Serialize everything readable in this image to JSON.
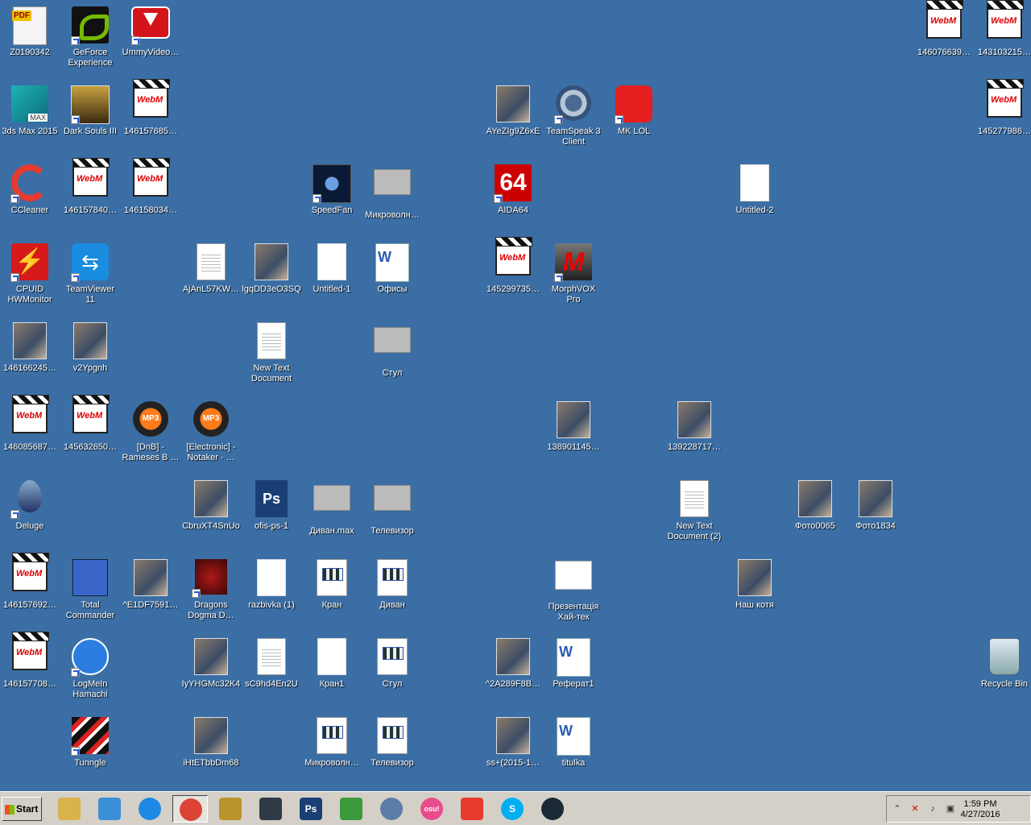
{
  "desktop_icons": [
    {
      "label": "Z0190342",
      "icon": "pdf-file-icon",
      "col": 0,
      "row": 0,
      "shortcut": false
    },
    {
      "label": "GeForce Experience",
      "icon": "nvidia-icon",
      "col": 1,
      "row": 0,
      "shortcut": true
    },
    {
      "label": "UmmyVideo…",
      "icon": "download-icon",
      "col": 2,
      "row": 0,
      "shortcut": true
    },
    {
      "label": "3ds Max 2015",
      "icon": "3dsmax-icon",
      "col": 0,
      "row": 1,
      "shortcut": false
    },
    {
      "label": "Dark Souls III",
      "icon": "game-icon",
      "col": 1,
      "row": 1,
      "shortcut": true
    },
    {
      "label": "146157685…",
      "icon": "webm-icon",
      "col": 2,
      "row": 1,
      "shortcut": false
    },
    {
      "label": "AYeZIg9Z6xE",
      "icon": "photo-icon",
      "col": 8,
      "row": 1,
      "shortcut": false
    },
    {
      "label": "TeamSpeak 3 Client",
      "icon": "teamspeak-icon",
      "col": 9,
      "row": 1,
      "shortcut": true
    },
    {
      "label": "MK LOL",
      "icon": "mk-lol-icon",
      "col": 10,
      "row": 1,
      "shortcut": true
    },
    {
      "label": "CCleaner",
      "icon": "ccleaner-icon",
      "col": 0,
      "row": 2,
      "shortcut": true
    },
    {
      "label": "146157840…",
      "icon": "webm-icon",
      "col": 1,
      "row": 2,
      "shortcut": false
    },
    {
      "label": "146158034…",
      "icon": "webm-icon",
      "col": 2,
      "row": 2,
      "shortcut": false
    },
    {
      "label": "SpeedFan",
      "icon": "speedfan-icon",
      "col": 5,
      "row": 2,
      "shortcut": true
    },
    {
      "label": "Микроволн…",
      "icon": "model-file-icon",
      "col": 6,
      "row": 2,
      "shortcut": false
    },
    {
      "label": "AIDA64",
      "icon": "aida64-icon",
      "col": 8,
      "row": 2,
      "shortcut": true
    },
    {
      "label": "Untitled-2",
      "icon": "image-icon",
      "col": 12,
      "row": 2,
      "shortcut": false
    },
    {
      "label": "CPUID HWMonitor",
      "icon": "cpuid-icon",
      "col": 0,
      "row": 3,
      "shortcut": true
    },
    {
      "label": "TeamViewer 11",
      "icon": "teamviewer-icon",
      "col": 1,
      "row": 3,
      "shortcut": true
    },
    {
      "label": "AjAnL57KW…",
      "icon": "text-file-icon",
      "col": 3,
      "row": 3,
      "shortcut": false
    },
    {
      "label": "lgqDD3eO3SQ",
      "icon": "photo-icon",
      "col": 4,
      "row": 3,
      "shortcut": false
    },
    {
      "label": "Untitled-1",
      "icon": "image-icon",
      "col": 5,
      "row": 3,
      "shortcut": false
    },
    {
      "label": "Офисы",
      "icon": "word-doc-icon",
      "col": 6,
      "row": 3,
      "shortcut": false
    },
    {
      "label": "145299735…",
      "icon": "webm-icon",
      "col": 8,
      "row": 3,
      "shortcut": false
    },
    {
      "label": "MorphVOX Pro",
      "icon": "morphvox-icon",
      "col": 9,
      "row": 3,
      "shortcut": true
    },
    {
      "label": "146166245…",
      "icon": "photo-icon",
      "col": 0,
      "row": 4,
      "shortcut": false
    },
    {
      "label": "v2Ypgnh",
      "icon": "photo-icon",
      "col": 1,
      "row": 4,
      "shortcut": false
    },
    {
      "label": "New Text Document",
      "icon": "text-file-icon",
      "col": 4,
      "row": 4,
      "shortcut": false
    },
    {
      "label": "Стул",
      "icon": "model-file-icon",
      "col": 6,
      "row": 4,
      "shortcut": false
    },
    {
      "label": "146085687…",
      "icon": "webm-icon",
      "col": 0,
      "row": 5,
      "shortcut": false
    },
    {
      "label": "145632650…",
      "icon": "webm-icon",
      "col": 1,
      "row": 5,
      "shortcut": false
    },
    {
      "label": "[DnB] - Rameses B …",
      "icon": "mp3-icon",
      "col": 2,
      "row": 5,
      "shortcut": false
    },
    {
      "label": "[Electronic] - Notaker - …",
      "icon": "mp3-icon",
      "col": 3,
      "row": 5,
      "shortcut": false
    },
    {
      "label": "138901145…",
      "icon": "photo-icon",
      "col": 9,
      "row": 5,
      "shortcut": false
    },
    {
      "label": "139228717…",
      "icon": "photo-icon",
      "col": 11,
      "row": 5,
      "shortcut": false
    },
    {
      "label": "Deluge",
      "icon": "deluge-icon",
      "col": 0,
      "row": 6,
      "shortcut": true
    },
    {
      "label": "CbruXT4SnUo",
      "icon": "photo-icon",
      "col": 3,
      "row": 6,
      "shortcut": false
    },
    {
      "label": "ofis-ps-1",
      "icon": "psd-icon",
      "col": 4,
      "row": 6,
      "shortcut": false
    },
    {
      "label": "Диван.max",
      "icon": "model-file-icon",
      "col": 5,
      "row": 6,
      "shortcut": false
    },
    {
      "label": "Телевизор",
      "icon": "model-file-icon",
      "col": 6,
      "row": 6,
      "shortcut": false
    },
    {
      "label": "New Text Document (2)",
      "icon": "text-file-icon",
      "col": 11,
      "row": 6,
      "shortcut": false
    },
    {
      "label": "Фото0065",
      "icon": "photo-icon",
      "col": 13,
      "row": 6,
      "shortcut": false
    },
    {
      "label": "Фото1834",
      "icon": "photo-icon",
      "col": 14,
      "row": 6,
      "shortcut": false
    },
    {
      "label": "146157692…",
      "icon": "webm-icon",
      "col": 0,
      "row": 7,
      "shortcut": false
    },
    {
      "label": "Total Commander",
      "icon": "floppy-icon",
      "col": 1,
      "row": 7,
      "shortcut": false
    },
    {
      "label": "^E1DF7591…",
      "icon": "photo-icon",
      "col": 2,
      "row": 7,
      "shortcut": false
    },
    {
      "label": "Dragons Dogma D…",
      "icon": "dragon-icon",
      "col": 3,
      "row": 7,
      "shortcut": true
    },
    {
      "label": "razbivka (1)",
      "icon": "image-icon",
      "col": 4,
      "row": 7,
      "shortcut": false
    },
    {
      "label": "Кран",
      "icon": "app-file-icon",
      "col": 5,
      "row": 7,
      "shortcut": false
    },
    {
      "label": "Диван",
      "icon": "app-file-icon",
      "col": 6,
      "row": 7,
      "shortcut": false
    },
    {
      "label": "Презентація Хай-тек",
      "icon": "presentation-icon",
      "col": 9,
      "row": 7,
      "shortcut": false
    },
    {
      "label": "Наш котя",
      "icon": "photo-icon",
      "col": 12,
      "row": 7,
      "shortcut": false
    },
    {
      "label": "146157708…",
      "icon": "webm-icon",
      "col": 0,
      "row": 8,
      "shortcut": false
    },
    {
      "label": "LogMeIn Hamachi",
      "icon": "hamachi-icon",
      "col": 1,
      "row": 8,
      "shortcut": true
    },
    {
      "label": "IyYHGMc32K4",
      "icon": "photo-icon",
      "col": 3,
      "row": 8,
      "shortcut": false
    },
    {
      "label": "sC9hd4En2U",
      "icon": "text-file-icon",
      "col": 4,
      "row": 8,
      "shortcut": false
    },
    {
      "label": "Кран1",
      "icon": "image-icon",
      "col": 5,
      "row": 8,
      "shortcut": false
    },
    {
      "label": "Стул",
      "icon": "app-file-icon",
      "col": 6,
      "row": 8,
      "shortcut": false
    },
    {
      "label": "^2A289F8B…",
      "icon": "photo-icon",
      "col": 8,
      "row": 8,
      "shortcut": false
    },
    {
      "label": "Реферат1",
      "icon": "word-doc-icon",
      "col": 9,
      "row": 8,
      "shortcut": false
    },
    {
      "label": "Recycle Bin",
      "icon": "recycle-bin-icon",
      "col": 16,
      "row": 8,
      "shortcut": false
    },
    {
      "label": "Tunngle",
      "icon": "tunngle-icon",
      "col": 1,
      "row": 9,
      "shortcut": true
    },
    {
      "label": "iHtETbbDm68",
      "icon": "photo-icon",
      "col": 3,
      "row": 9,
      "shortcut": false
    },
    {
      "label": "Микроволн…",
      "icon": "app-file-icon",
      "col": 5,
      "row": 9,
      "shortcut": false
    },
    {
      "label": "Телевизор",
      "icon": "app-file-icon",
      "col": 6,
      "row": 9,
      "shortcut": false
    },
    {
      "label": "ss+(2015-1…",
      "icon": "photo-icon",
      "col": 8,
      "row": 9,
      "shortcut": false
    },
    {
      "label": "titulka",
      "icon": "word-doc-icon",
      "col": 9,
      "row": 9,
      "shortcut": false
    },
    {
      "label": "146076639…",
      "icon": "webm-icon",
      "col": 15,
      "row": 0,
      "shortcut": false
    },
    {
      "label": "143103215…",
      "icon": "webm-icon",
      "col": 16,
      "row": 0,
      "shortcut": false
    },
    {
      "label": "145277986…",
      "icon": "webm-icon",
      "col": 16,
      "row": 1,
      "shortcut": false
    }
  ],
  "taskbar": {
    "start_label": "Start",
    "apps": [
      {
        "name": "explorer-icon",
        "color": "#d9b24a"
      },
      {
        "name": "media-player-icon",
        "color": "#3b8fd6"
      },
      {
        "name": "internet-explorer-icon",
        "color": "#1e88e5"
      },
      {
        "name": "chrome-icon",
        "color": "#db4437",
        "active": true
      },
      {
        "name": "league-of-legends-icon",
        "color": "#b9952c"
      },
      {
        "name": "steam-like-icon",
        "color": "#2e3a45"
      },
      {
        "name": "photoshop-icon",
        "color": "#1a3f74",
        "text": "Ps"
      },
      {
        "name": "money-icon",
        "color": "#3c9a3c"
      },
      {
        "name": "teamspeak-icon",
        "color": "#5c7da8"
      },
      {
        "name": "osu-icon",
        "color": "#e84c8b",
        "text": "osu!"
      },
      {
        "name": "ccleaner-icon",
        "color": "#e63b2e"
      },
      {
        "name": "skype-icon",
        "color": "#00aff0",
        "text": "S"
      },
      {
        "name": "steam-icon",
        "color": "#1b2838"
      }
    ],
    "tray_icons": [
      "show-hidden-icon",
      "network-error-icon",
      "volume-icon",
      "network-icon"
    ],
    "clock_time": "1:59 PM",
    "clock_date": "4/27/2016"
  }
}
